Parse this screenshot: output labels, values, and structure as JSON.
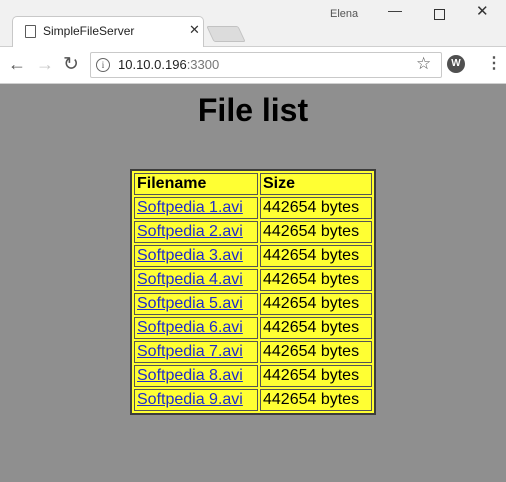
{
  "browser": {
    "tab_title": "SimpleFileServer",
    "tab_close": "✕",
    "user": "Elena",
    "window_controls": {
      "minimize": "—",
      "close": "✕"
    },
    "toolbar": {
      "back_icon": "←",
      "forward_icon": "→",
      "reload_icon": "↻",
      "info_icon": "i",
      "url_host": "10.10.0.196",
      "url_port": ":3300",
      "star_icon": "☆",
      "extension_icon": "W",
      "menu_icon": "⋮"
    }
  },
  "page": {
    "title": "File list",
    "table": {
      "headers": [
        "Filename",
        "Size"
      ],
      "rows": [
        {
          "name": "Softpedia 1.avi",
          "size": "442654 bytes"
        },
        {
          "name": "Softpedia 2.avi",
          "size": "442654 bytes"
        },
        {
          "name": "Softpedia 3.avi",
          "size": "442654 bytes"
        },
        {
          "name": "Softpedia 4.avi",
          "size": "442654 bytes"
        },
        {
          "name": "Softpedia 5.avi",
          "size": "442654 bytes"
        },
        {
          "name": "Softpedia 6.avi",
          "size": "442654 bytes"
        },
        {
          "name": "Softpedia 7.avi",
          "size": "442654 bytes"
        },
        {
          "name": "Softpedia 8.avi",
          "size": "442654 bytes"
        },
        {
          "name": "Softpedia 9.avi",
          "size": "442654 bytes"
        }
      ]
    }
  },
  "colors": {
    "page_background": "#8f8f8f",
    "table_background": "#ffff33",
    "link": "#1f2bcc"
  }
}
